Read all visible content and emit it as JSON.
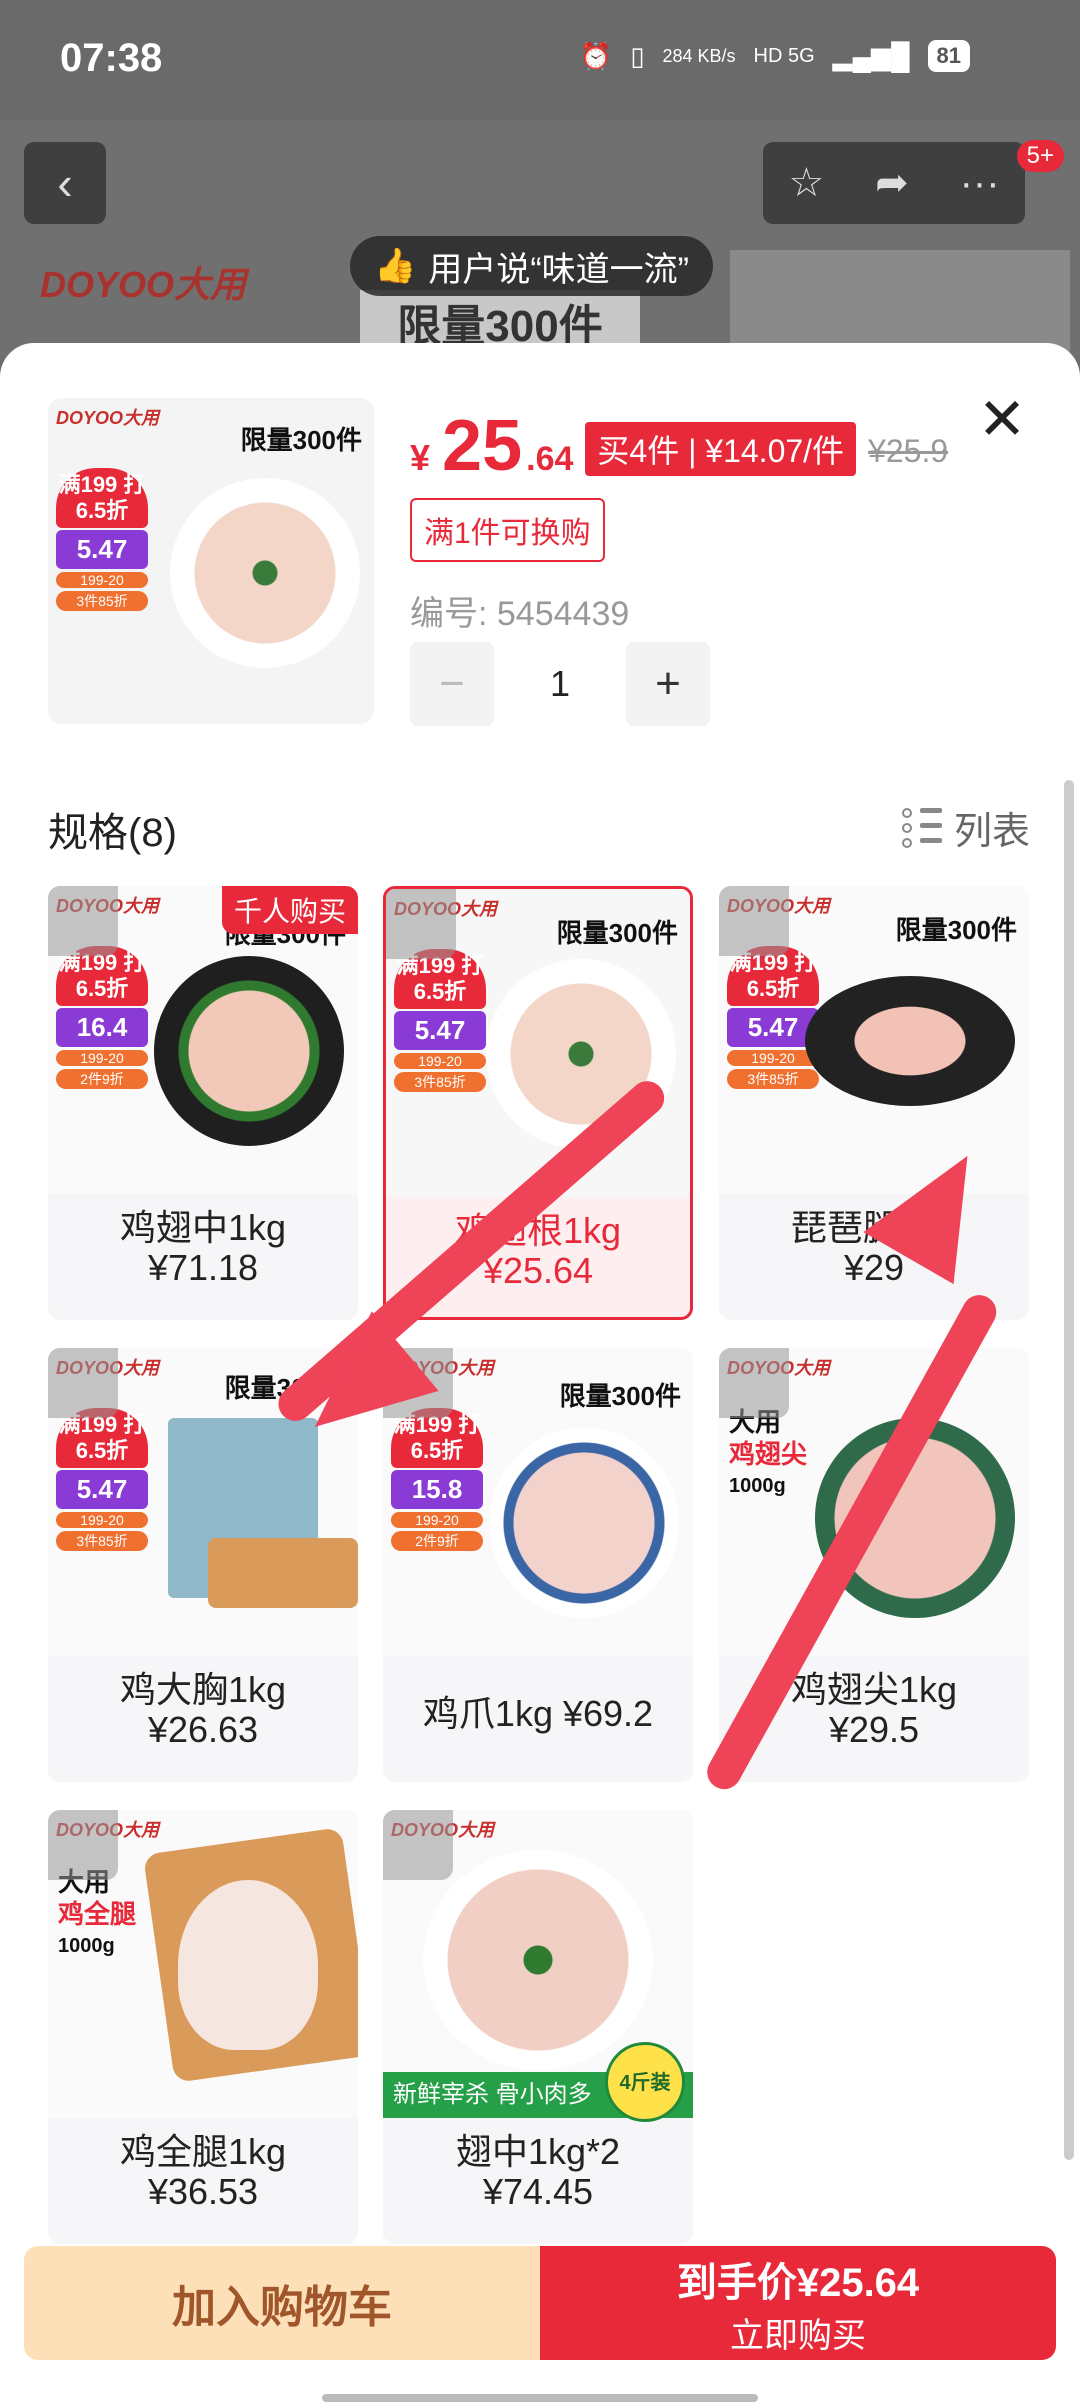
{
  "status_bar": {
    "time": "07:38",
    "speed": "284 KB/s",
    "net": "HD 5G",
    "battery": "81"
  },
  "header": {
    "badge": "5+",
    "brand_bg": "DOYOO大用",
    "tip": "用户说“味道一流”",
    "banner_bg": "限量300件"
  },
  "product": {
    "currency": "¥",
    "price_int": "25",
    "price_dec": ".64",
    "promo": "买4件 | ¥14.07/件",
    "original_price": "¥25.9",
    "tag": "满1件可换购",
    "sku": "编号: 5454439",
    "quantity": "1",
    "thumb_brand": "DOYOO大用",
    "thumb_limit": "限量300件",
    "thumb_flame_top": "满199 打6.5折",
    "thumb_flame_price": "5.47",
    "thumb_pill1": "199-20",
    "thumb_pill2": "3件85折"
  },
  "specs": {
    "title": "规格(8)",
    "view_toggle": "列表",
    "hot_label": "千人购买",
    "items": [
      {
        "name": "鸡翅中1kg",
        "price": "¥71.18",
        "limit": "限量300件",
        "flame_price": "16.4",
        "pill2": "2件9折"
      },
      {
        "name": "鸡翅根1kg",
        "price": "¥25.64",
        "limit": "限量300件",
        "flame_price": "5.47",
        "pill2": "3件85折"
      },
      {
        "name": "琵琶腿1kg",
        "price": "¥29",
        "limit": "限量300件",
        "flame_price": "5.47",
        "pill2": "3件85折"
      },
      {
        "name": "鸡大胸1kg",
        "price": "¥26.63",
        "limit": "限量300件",
        "flame_price": "5.47",
        "pill2": "3件85折"
      },
      {
        "name": "鸡爪1kg ¥69.2",
        "limit": "限量300件",
        "flame_price": "15.8",
        "pill2": "2件9折"
      },
      {
        "name": "鸡翅尖1kg",
        "price": "¥29.5",
        "side1": "大用",
        "side2": "鸡翅尖",
        "side3": "1000g"
      },
      {
        "name": "鸡全腿1kg",
        "price": "¥36.53",
        "side1": "大用",
        "side2": "鸡全腿",
        "side3": "1000g"
      },
      {
        "name": "翅中1kg*2",
        "price": "¥74.45",
        "strip": "新鲜宰杀 骨小肉多",
        "corner": "4斤装"
      }
    ],
    "brand": "DOYOO大用",
    "flame_top": "满199 打6.5折",
    "pill1": "199-20"
  },
  "bottom": {
    "cart": "加入购物车",
    "buy_top": "到手价¥25.64",
    "buy_bottom": "立即购买"
  },
  "colors": {
    "accent": "#e8293a",
    "cart_bg": "#fde0b8",
    "arrow": "#ef4358"
  }
}
